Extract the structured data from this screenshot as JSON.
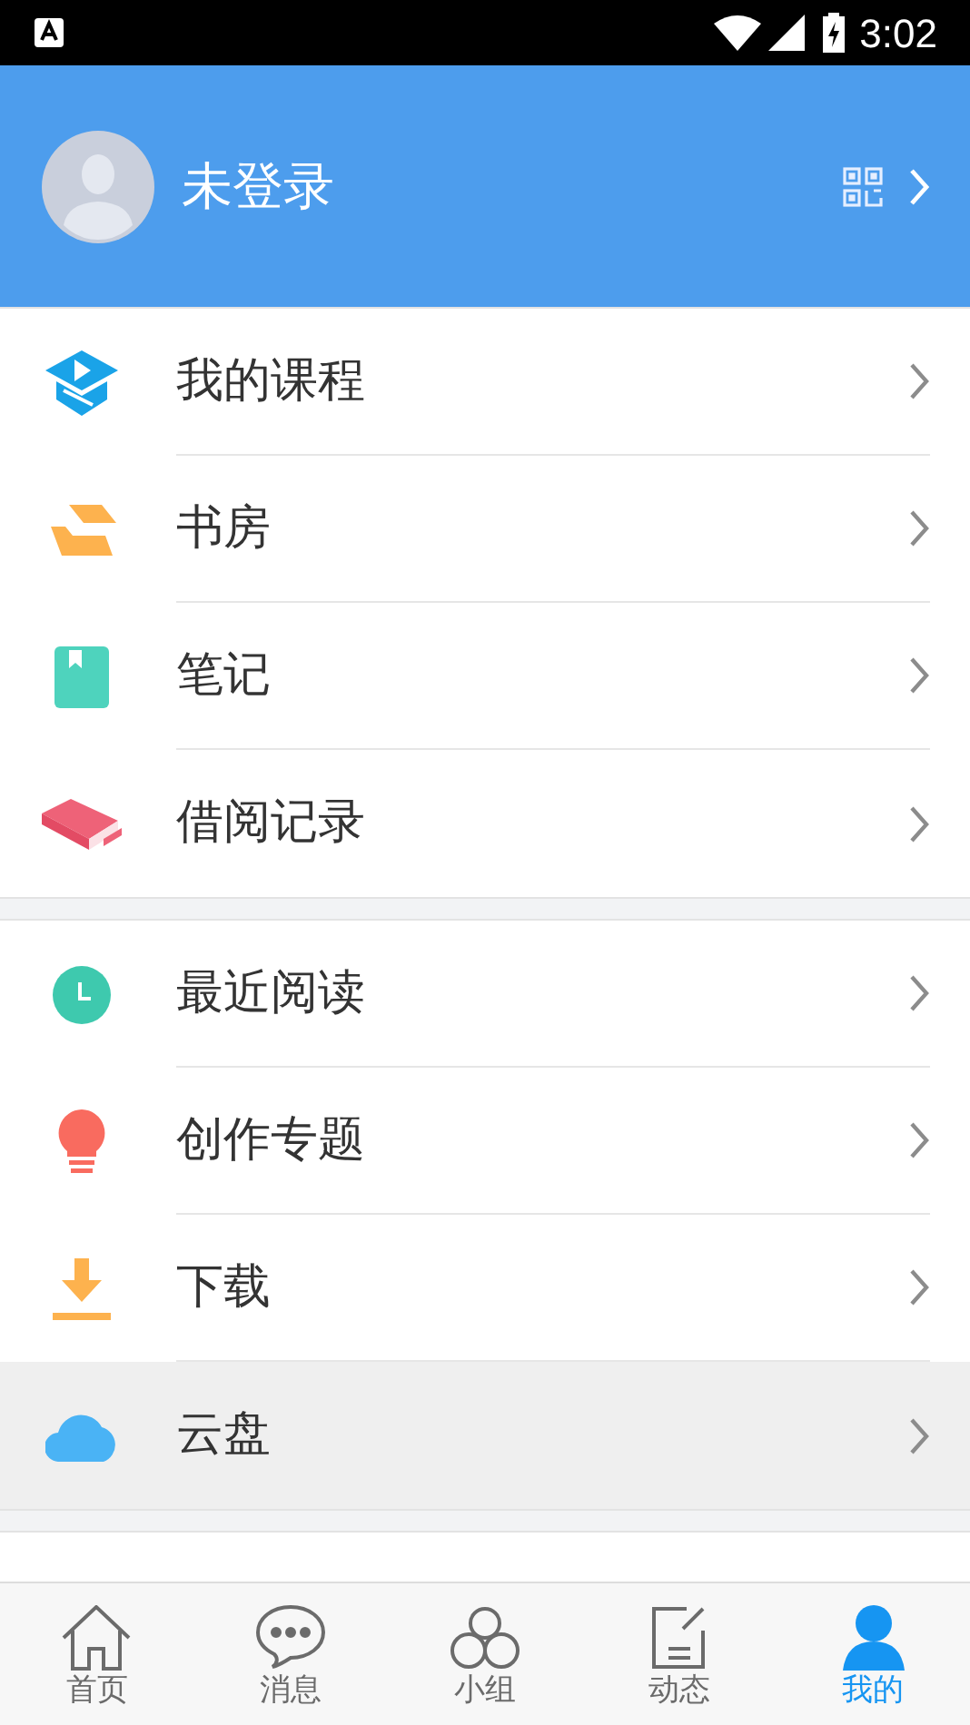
{
  "status_bar": {
    "time": "3:02"
  },
  "profile": {
    "name": "未登录"
  },
  "groups": [
    {
      "items": [
        {
          "kind": "course",
          "label": "我的课程",
          "pressed": false
        },
        {
          "kind": "study",
          "label": "书房",
          "pressed": false
        },
        {
          "kind": "notes",
          "label": "笔记",
          "pressed": false
        },
        {
          "kind": "borrow",
          "label": "借阅记录",
          "pressed": false
        }
      ]
    },
    {
      "items": [
        {
          "kind": "recent",
          "label": "最近阅读",
          "pressed": false
        },
        {
          "kind": "topic",
          "label": "创作专题",
          "pressed": false
        },
        {
          "kind": "download",
          "label": "下载",
          "pressed": false
        },
        {
          "kind": "cloud",
          "label": "云盘",
          "pressed": true
        }
      ]
    }
  ],
  "tabs": [
    {
      "kind": "home",
      "label": "首页",
      "selected": false
    },
    {
      "kind": "message",
      "label": "消息",
      "selected": false
    },
    {
      "kind": "group",
      "label": "小组",
      "selected": false
    },
    {
      "kind": "feed",
      "label": "动态",
      "selected": false
    },
    {
      "kind": "me",
      "label": "我的",
      "selected": true
    }
  ]
}
